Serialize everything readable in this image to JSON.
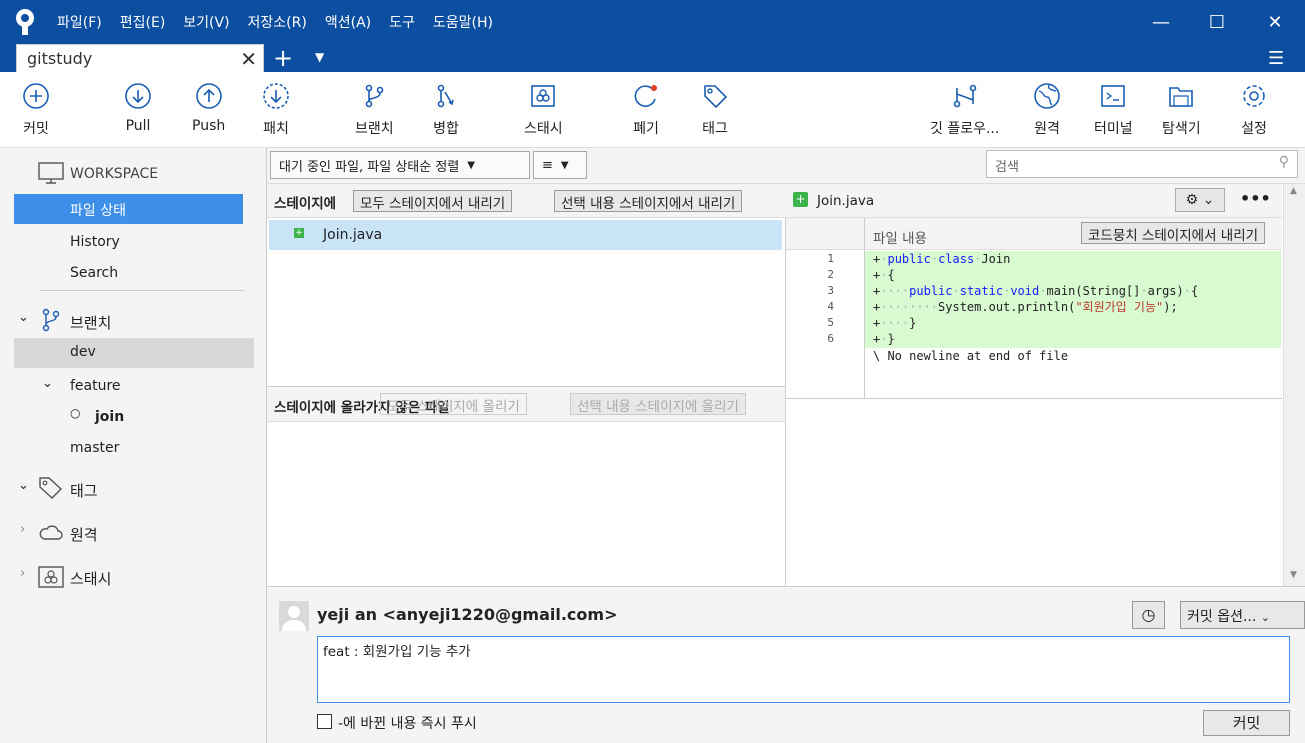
{
  "menu": [
    "파일(F)",
    "편집(E)",
    "보기(V)",
    "저장소(R)",
    "액션(A)",
    "도구",
    "도움말(H)"
  ],
  "tab": {
    "title": "gitstudy"
  },
  "toolbar": {
    "commit": "커밋",
    "pull": "Pull",
    "push": "Push",
    "fetch": "패치",
    "branch": "브랜치",
    "merge": "병합",
    "stash": "스태시",
    "discard": "폐기",
    "tag": "태그",
    "gitflow": "깃 플로우...",
    "remote": "원격",
    "terminal": "터미널",
    "explorer": "탐색기",
    "settings": "설정"
  },
  "sidebar": {
    "workspace": "WORKSPACE",
    "file_status": "파일 상태",
    "history": "History",
    "search": "Search",
    "branches": "브랜치",
    "branch_dev": "dev",
    "branch_feature": "feature",
    "branch_join": "join",
    "branch_master": "master",
    "tags": "태그",
    "remotes": "원격",
    "stashes": "스태시"
  },
  "filter": {
    "sort": "대기 중인 파일, 파일 상태순 정렬",
    "search_placeholder": "검색"
  },
  "staged": {
    "title": "스테이지에",
    "unstage_all": "모두 스테이지에서 내리기",
    "unstage_selected": "선택 내용 스테이지에서 내리기",
    "files": [
      "Join.java"
    ]
  },
  "unstaged": {
    "title": "스테이지에 올라가지 않은 파일",
    "stage_all": "모두 스테이지에 올리기",
    "stage_selected": "선택 내용 스테이지에 올리기"
  },
  "diff": {
    "file": "Join.java",
    "hunk_label": "파일 내용",
    "unstage_hunk": "코드뭉치 스테이지에서 내리기",
    "line_numbers": [
      "1",
      "2",
      "3",
      "4",
      "5",
      "6"
    ],
    "no_newline": "\\ No newline at end of file"
  },
  "commit": {
    "author": "yeji an <anyeji1220@gmail.com>",
    "options": "커밋 옵션...",
    "message": "feat : 회원가입 기능 추가",
    "push_checkbox": "-에 바뀐 내용 즉시 푸시",
    "commit_button": "커밋"
  },
  "colors": {
    "titlebar": "#0c4ea0",
    "selected": "#3d8fe8",
    "added_line": "#d8fad0",
    "staged_row": "#c9e4f6"
  }
}
